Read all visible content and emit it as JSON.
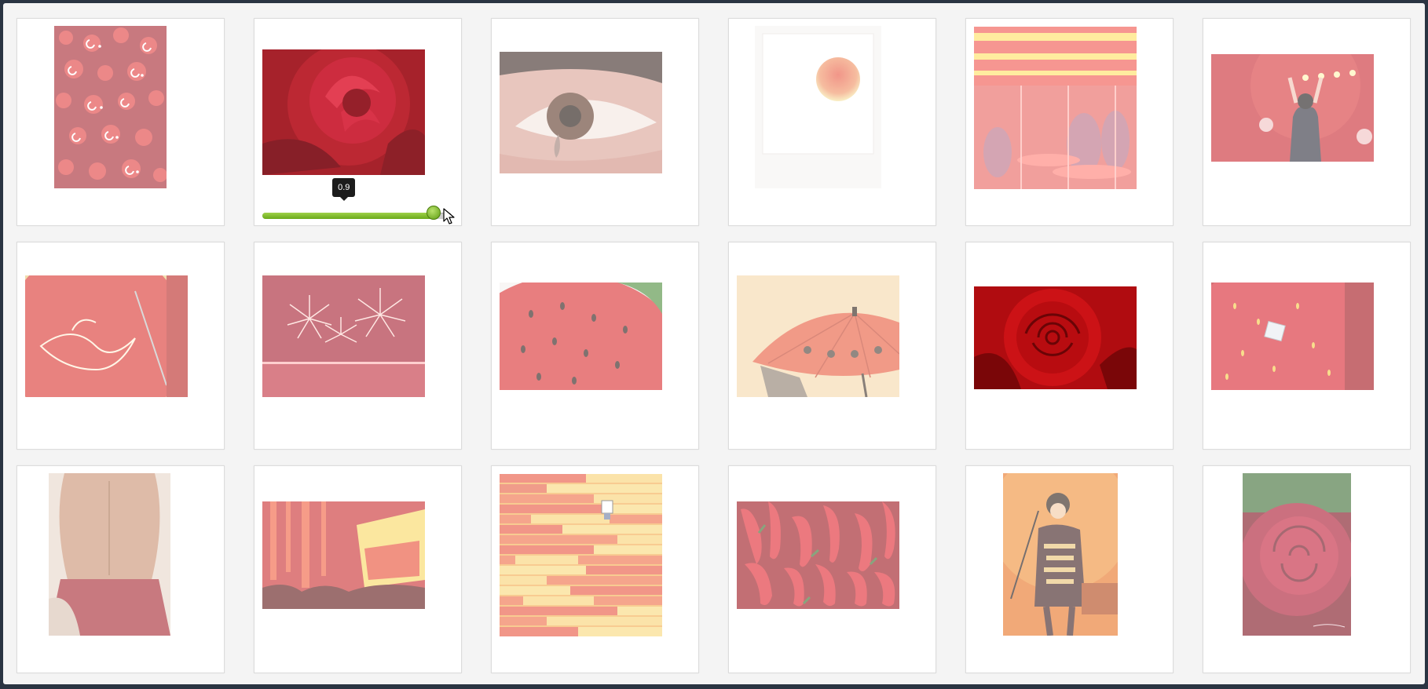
{
  "gallery": {
    "images": [
      {
        "subject": "flags",
        "opacity": 0.6
      },
      {
        "subject": "rose",
        "opacity": 0.9
      },
      {
        "subject": "eye",
        "opacity": 0.6
      },
      {
        "subject": "sun",
        "opacity": 0.6
      },
      {
        "subject": "cafe",
        "opacity": 0.6
      },
      {
        "subject": "singer",
        "opacity": 0.6
      },
      {
        "subject": "embroidery",
        "opacity": 0.6
      },
      {
        "subject": "fireworks",
        "opacity": 0.6
      },
      {
        "subject": "strawberry",
        "opacity": 0.6
      },
      {
        "subject": "parasol",
        "opacity": 0.6
      },
      {
        "subject": "rose",
        "opacity": 1.0
      },
      {
        "subject": "strawberry-ring",
        "opacity": 0.6
      },
      {
        "subject": "back",
        "opacity": 0.6
      },
      {
        "subject": "concert",
        "opacity": 0.6
      },
      {
        "subject": "stripes",
        "opacity": 0.6
      },
      {
        "subject": "peppers",
        "opacity": 0.6
      },
      {
        "subject": "singer",
        "opacity": 0.6
      },
      {
        "subject": "rose",
        "opacity": 0.6
      }
    ]
  },
  "opacity_control": {
    "value": 0.9,
    "tooltip": "0.9"
  },
  "colors": {
    "accent": "#6aaa1a",
    "background": "#f4f4f4",
    "card": "#ffffff"
  }
}
